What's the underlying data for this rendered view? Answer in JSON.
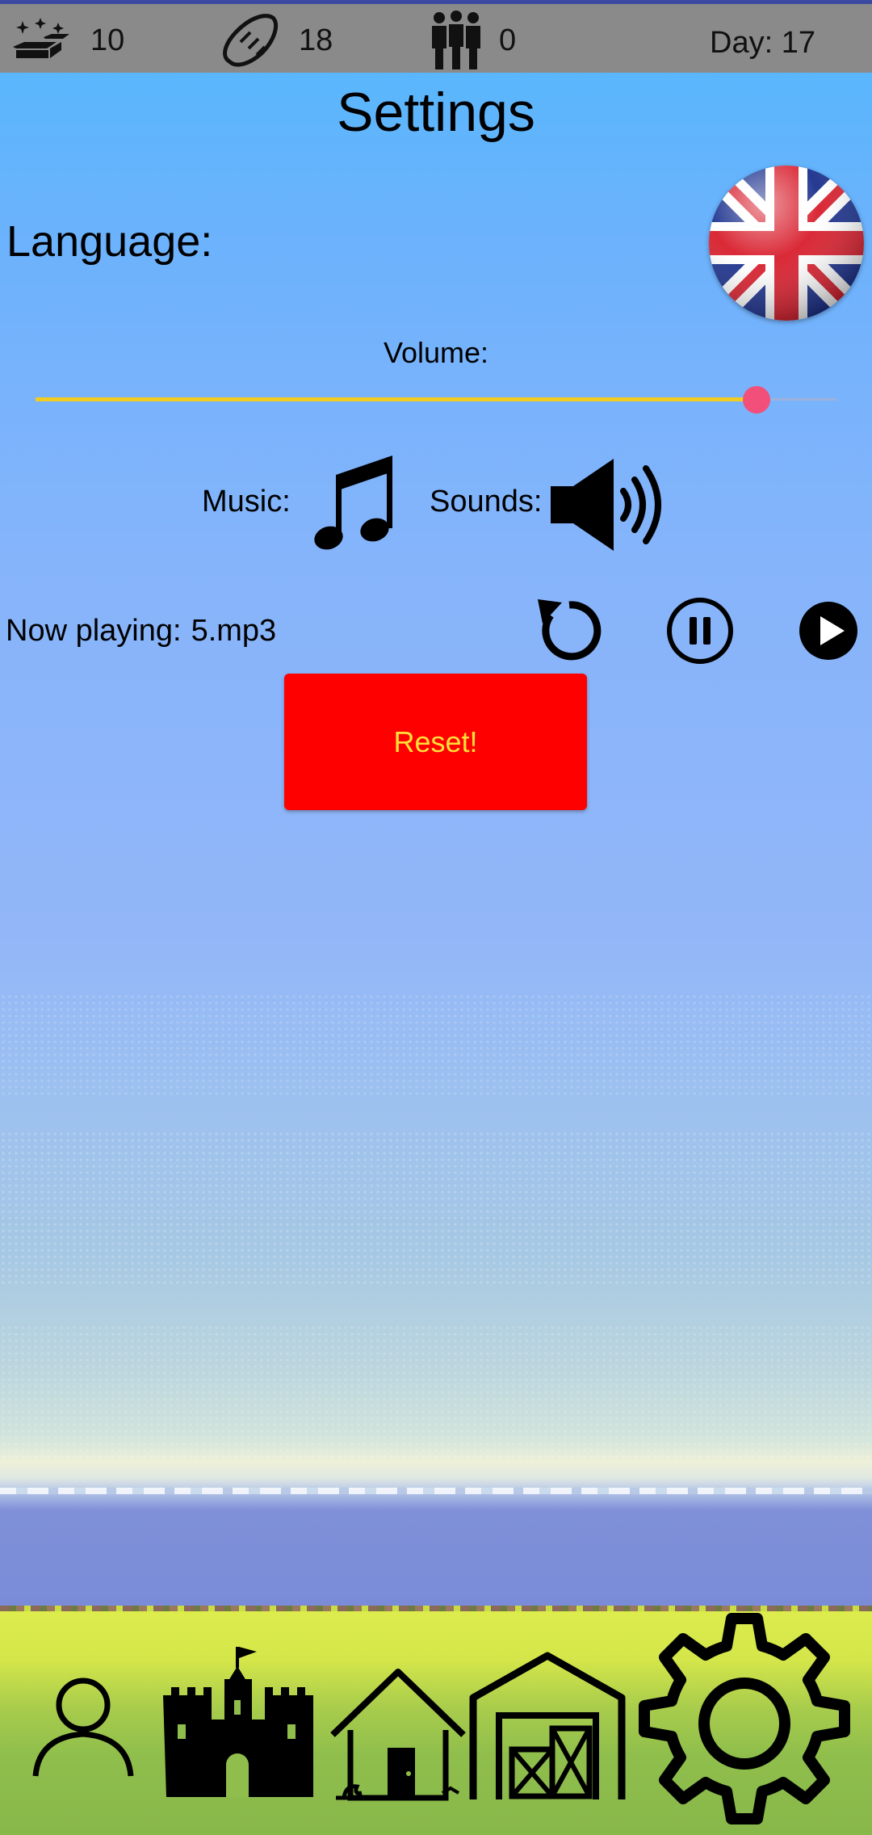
{
  "status_bar": {
    "gold": {
      "icon": "gold-bars-icon",
      "value": "10"
    },
    "food": {
      "icon": "bread-icon",
      "value": "18"
    },
    "population": {
      "icon": "people-icon",
      "value": "0"
    },
    "day": "Day: 17"
  },
  "settings": {
    "title": "Settings",
    "language_label": "Language:",
    "language_flag": "uk-flag-icon",
    "volume_label": "Volume:",
    "volume_level": 0.9,
    "music_label": "Music:",
    "sounds_label": "Sounds:",
    "now_playing_label": "Now playing:",
    "now_playing_track": "5.mp3",
    "reset_label": "Reset!"
  },
  "colors": {
    "status_bar": "#8a8a8a",
    "slider_fill": "#f2cc1f",
    "slider_thumb": "#f24f7b",
    "reset_bg": "#ff0000",
    "reset_text": "#ffe03a"
  },
  "nav": [
    {
      "icon": "profile-icon"
    },
    {
      "icon": "castle-icon"
    },
    {
      "icon": "house-icon"
    },
    {
      "icon": "barn-icon"
    },
    {
      "icon": "gear-icon"
    }
  ]
}
